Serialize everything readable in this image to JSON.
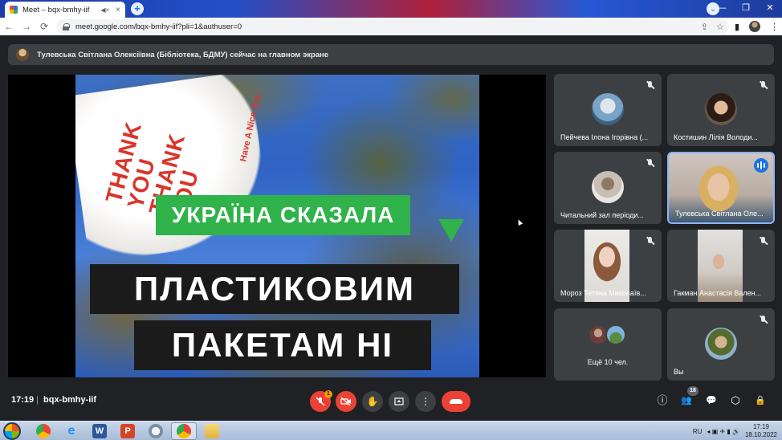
{
  "browser": {
    "tab_title": "Meet – bqx-bmhy-iif",
    "tab_audio": "◀×",
    "tab_close": "×",
    "new_tab": "+",
    "tab_search": "⌄",
    "url": "meet.google.com/bqx-bmhy-iif?pli=1&authuser=0",
    "window_controls": [
      "—",
      "❐",
      "✕"
    ],
    "nav": [
      "←",
      "→",
      "⟳"
    ]
  },
  "notice": {
    "text": "Тулевська Світлана Олексіївна (Бібліотека, БДМУ) сейчас на главном экране"
  },
  "slide": {
    "bag_text": "THANK YOU THANK YOU",
    "bag_sub": "Have A Nice Day",
    "green_banner": "УКРАЇНА СКАЗАЛА",
    "black_line_1": "ПЛАСТИКОВИМ",
    "black_line_2": "ПАКЕТАМ НІ",
    "colors": {
      "green": "#2fb34a",
      "black": "#1b1b1b",
      "sky": "#2f63c4"
    }
  },
  "participants": [
    {
      "name": "Пейчева Ілона Ігорівна (...",
      "muted": true,
      "avatar": "photo"
    },
    {
      "name": "Костишин Лілія Володи...",
      "muted": true,
      "avatar": "photo"
    },
    {
      "name": "Читальний зал періоди...",
      "muted": true,
      "avatar": "photo"
    },
    {
      "name": "Тулевська Світлана Оле...",
      "muted": false,
      "speaking": true,
      "avatar": "video"
    },
    {
      "name": "Мороз Тетяна Миколаїв...",
      "muted": true,
      "avatar": "video"
    },
    {
      "name": "Гакман Анастасія Вален...",
      "muted": true,
      "avatar": "video"
    },
    {
      "name": "Ещё 10 чел.",
      "muted": false,
      "avatar": "stack"
    },
    {
      "name": "Вы",
      "muted": true,
      "avatar": "photo"
    }
  ],
  "bottom_bar": {
    "time": "17:19",
    "separator": "|",
    "meeting_code": "bqx-bmhy-iif",
    "mic_badge": "1",
    "people_count": "18",
    "icons": {
      "info": "ⓘ",
      "people": "👥",
      "chat": "💬",
      "activities": "⬡",
      "host": "🔒"
    }
  },
  "taskbar": {
    "lang": "RU",
    "time": "17:19",
    "date": "18.10.2022",
    "apps": [
      "chrome-icon",
      "ie-icon",
      "word-icon",
      "powerpoint-icon",
      "paint-icon",
      "chrome-icon",
      "explorer-icon"
    ]
  }
}
